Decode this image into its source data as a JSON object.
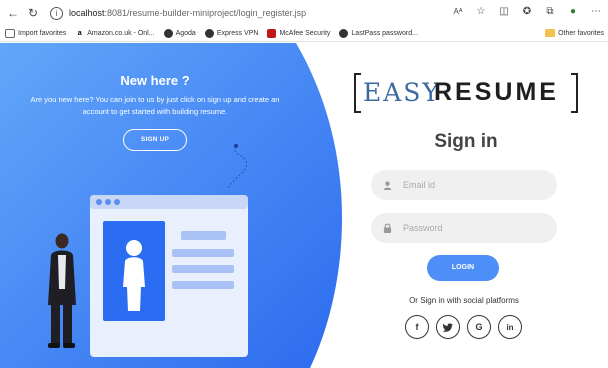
{
  "browser": {
    "url_host": "localhost",
    "url_path": ":8081/resume-builder-miniproject/login_register.jsp",
    "read_aloud": "Aᴬ"
  },
  "bookmarks": [
    {
      "label": "Import favorites",
      "icon": "import-icon"
    },
    {
      "label": "Amazon.co.uk - Onl...",
      "icon": "amazon-icon"
    },
    {
      "label": "Agoda",
      "icon": "agoda-icon"
    },
    {
      "label": "Express VPN",
      "icon": "expressvpn-icon"
    },
    {
      "label": "McAfee Security",
      "icon": "mcafee-icon"
    },
    {
      "label": "LastPass password...",
      "icon": "lastpass-icon"
    }
  ],
  "other_favorites": "Other favorites",
  "left_panel": {
    "title": "New here ?",
    "description": "Are you new here? You can join to us by just click on sign up and create an account to get started with building resume.",
    "signup_label": "SIGN UP"
  },
  "logo": {
    "easy": "EASY",
    "resume": "RESUME"
  },
  "form": {
    "title": "Sign in",
    "email_placeholder": "Email id",
    "password_placeholder": "Password",
    "login_label": "LOGIN",
    "social_text": "Or Sign in with social platforms"
  },
  "social": [
    {
      "glyph": "f",
      "icon": "facebook-icon"
    },
    {
      "glyph": "🐦",
      "icon": "twitter-icon"
    },
    {
      "glyph": "G",
      "icon": "google-icon"
    },
    {
      "glyph": "in",
      "icon": "linkedin-icon"
    }
  ],
  "colors": {
    "primary_blue": "#4d8ff6",
    "gradient_start": "#5aa0f9",
    "gradient_end": "#2f6ff0"
  }
}
